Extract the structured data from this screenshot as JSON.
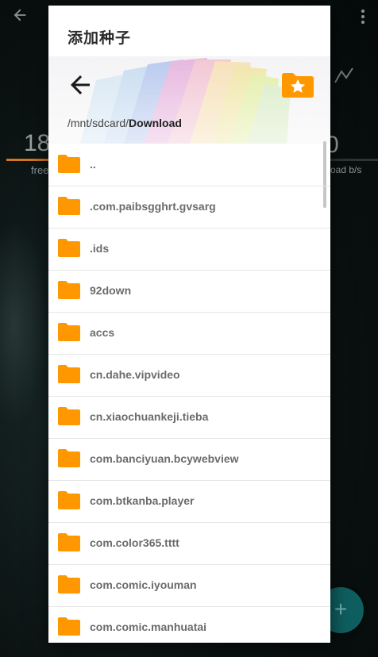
{
  "background": {
    "stat_left": "18",
    "stat_left_caption": "free",
    "stat_right": "0",
    "stat_right_caption": "oad b/s",
    "fab_icon": "plus-icon",
    "colors": {
      "accent_bar": "#d3781d",
      "fab": "#0f5f60"
    }
  },
  "dialog": {
    "title": "添加种子",
    "path_prefix": "/mnt/sdcard/",
    "path_current": "Download",
    "back_icon": "arrow-left-icon",
    "favorite_icon": "folder-star-icon",
    "colors": {
      "folder": "#ff9800",
      "label": "#6b6b6b",
      "divider": "#e6e6e6"
    },
    "items": [
      {
        "label": ".."
      },
      {
        "label": ".com.paibsgghrt.gvsarg"
      },
      {
        "label": ".ids"
      },
      {
        "label": "92down"
      },
      {
        "label": "accs"
      },
      {
        "label": "cn.dahe.vipvideo"
      },
      {
        "label": "cn.xiaochuankeji.tieba"
      },
      {
        "label": "com.banciyuan.bcywebview"
      },
      {
        "label": "com.btkanba.player"
      },
      {
        "label": "com.color365.tttt"
      },
      {
        "label": "com.comic.iyouman"
      },
      {
        "label": "com.comic.manhuatai"
      }
    ]
  }
}
